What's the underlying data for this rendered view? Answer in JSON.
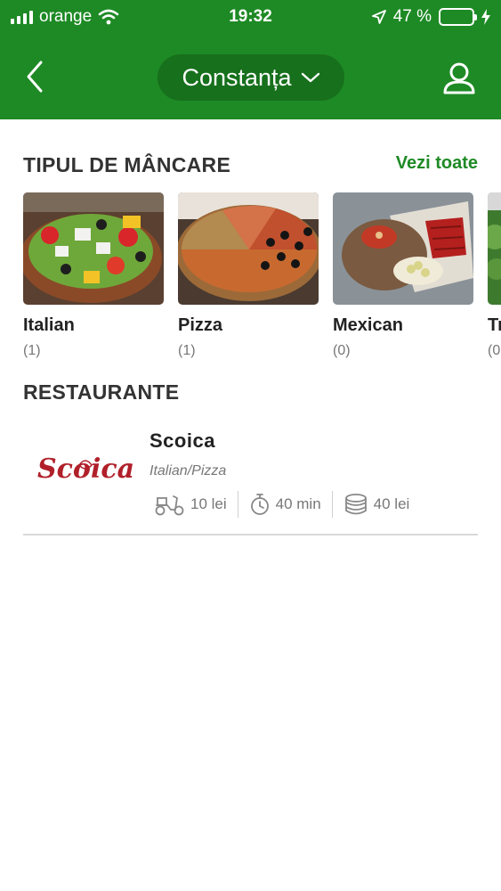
{
  "status_bar": {
    "carrier": "orange",
    "time": "19:32",
    "battery": "47 %",
    "battery_level": 0.47
  },
  "header": {
    "city": "Constanța"
  },
  "categories_section": {
    "title": "TIPUL DE MÂNCARE",
    "see_all": "Vezi toate",
    "items": [
      {
        "name": "Italian",
        "count": "(1)"
      },
      {
        "name": "Pizza",
        "count": "(1)"
      },
      {
        "name": "Mexican",
        "count": "(0)"
      },
      {
        "name": "Tr",
        "count": "(0"
      }
    ]
  },
  "restaurants_section": {
    "title": "RESTAURANTE",
    "items": [
      {
        "name": "Scoica",
        "logo_text": "Scoica",
        "cuisine": "Italian/Pizza",
        "delivery_cost": "10 lei",
        "delivery_time": "40 min",
        "min_order": "40 lei"
      }
    ]
  },
  "colors": {
    "brand_green": "#1e8a25",
    "pill_green": "#17701c",
    "logo_red": "#b0202a"
  },
  "icons": [
    "signal-icon",
    "wifi-icon",
    "location-arrow-icon",
    "battery-icon",
    "charging-icon",
    "back-chevron-icon",
    "dropdown-chevron-icon",
    "user-icon",
    "scooter-icon",
    "stopwatch-icon",
    "coins-icon"
  ]
}
